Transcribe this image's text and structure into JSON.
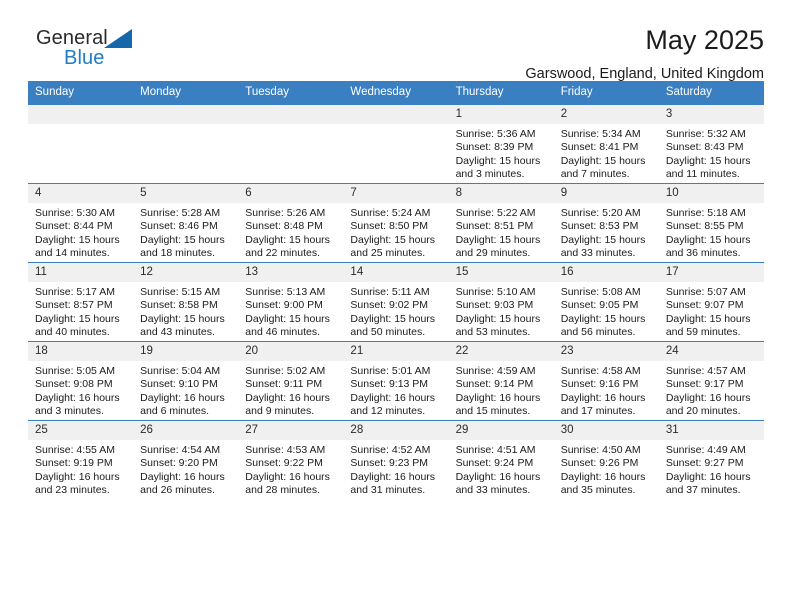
{
  "brand": {
    "name_top": "General",
    "name_bottom": "Blue",
    "accent_color": "#1567ab",
    "triangle_icon": "triangle-icon"
  },
  "header": {
    "title": "May 2025",
    "location": "Garswood, England, United Kingdom"
  },
  "calendar": {
    "header_bg": "#3a7fc1",
    "daynum_bg": "#f0f0f0",
    "weekday_headers": [
      "Sunday",
      "Monday",
      "Tuesday",
      "Wednesday",
      "Thursday",
      "Friday",
      "Saturday"
    ],
    "weeks": [
      [
        {
          "day": "",
          "empty": true
        },
        {
          "day": "",
          "empty": true
        },
        {
          "day": "",
          "empty": true
        },
        {
          "day": "",
          "empty": true
        },
        {
          "day": "1",
          "sunrise": "Sunrise: 5:36 AM",
          "sunset": "Sunset: 8:39 PM",
          "daylight": "Daylight: 15 hours and 3 minutes."
        },
        {
          "day": "2",
          "sunrise": "Sunrise: 5:34 AM",
          "sunset": "Sunset: 8:41 PM",
          "daylight": "Daylight: 15 hours and 7 minutes."
        },
        {
          "day": "3",
          "sunrise": "Sunrise: 5:32 AM",
          "sunset": "Sunset: 8:43 PM",
          "daylight": "Daylight: 15 hours and 11 minutes."
        }
      ],
      [
        {
          "day": "4",
          "sunrise": "Sunrise: 5:30 AM",
          "sunset": "Sunset: 8:44 PM",
          "daylight": "Daylight: 15 hours and 14 minutes."
        },
        {
          "day": "5",
          "sunrise": "Sunrise: 5:28 AM",
          "sunset": "Sunset: 8:46 PM",
          "daylight": "Daylight: 15 hours and 18 minutes."
        },
        {
          "day": "6",
          "sunrise": "Sunrise: 5:26 AM",
          "sunset": "Sunset: 8:48 PM",
          "daylight": "Daylight: 15 hours and 22 minutes."
        },
        {
          "day": "7",
          "sunrise": "Sunrise: 5:24 AM",
          "sunset": "Sunset: 8:50 PM",
          "daylight": "Daylight: 15 hours and 25 minutes."
        },
        {
          "day": "8",
          "sunrise": "Sunrise: 5:22 AM",
          "sunset": "Sunset: 8:51 PM",
          "daylight": "Daylight: 15 hours and 29 minutes."
        },
        {
          "day": "9",
          "sunrise": "Sunrise: 5:20 AM",
          "sunset": "Sunset: 8:53 PM",
          "daylight": "Daylight: 15 hours and 33 minutes."
        },
        {
          "day": "10",
          "sunrise": "Sunrise: 5:18 AM",
          "sunset": "Sunset: 8:55 PM",
          "daylight": "Daylight: 15 hours and 36 minutes."
        }
      ],
      [
        {
          "day": "11",
          "sunrise": "Sunrise: 5:17 AM",
          "sunset": "Sunset: 8:57 PM",
          "daylight": "Daylight: 15 hours and 40 minutes."
        },
        {
          "day": "12",
          "sunrise": "Sunrise: 5:15 AM",
          "sunset": "Sunset: 8:58 PM",
          "daylight": "Daylight: 15 hours and 43 minutes."
        },
        {
          "day": "13",
          "sunrise": "Sunrise: 5:13 AM",
          "sunset": "Sunset: 9:00 PM",
          "daylight": "Daylight: 15 hours and 46 minutes."
        },
        {
          "day": "14",
          "sunrise": "Sunrise: 5:11 AM",
          "sunset": "Sunset: 9:02 PM",
          "daylight": "Daylight: 15 hours and 50 minutes."
        },
        {
          "day": "15",
          "sunrise": "Sunrise: 5:10 AM",
          "sunset": "Sunset: 9:03 PM",
          "daylight": "Daylight: 15 hours and 53 minutes."
        },
        {
          "day": "16",
          "sunrise": "Sunrise: 5:08 AM",
          "sunset": "Sunset: 9:05 PM",
          "daylight": "Daylight: 15 hours and 56 minutes."
        },
        {
          "day": "17",
          "sunrise": "Sunrise: 5:07 AM",
          "sunset": "Sunset: 9:07 PM",
          "daylight": "Daylight: 15 hours and 59 minutes."
        }
      ],
      [
        {
          "day": "18",
          "sunrise": "Sunrise: 5:05 AM",
          "sunset": "Sunset: 9:08 PM",
          "daylight": "Daylight: 16 hours and 3 minutes."
        },
        {
          "day": "19",
          "sunrise": "Sunrise: 5:04 AM",
          "sunset": "Sunset: 9:10 PM",
          "daylight": "Daylight: 16 hours and 6 minutes."
        },
        {
          "day": "20",
          "sunrise": "Sunrise: 5:02 AM",
          "sunset": "Sunset: 9:11 PM",
          "daylight": "Daylight: 16 hours and 9 minutes."
        },
        {
          "day": "21",
          "sunrise": "Sunrise: 5:01 AM",
          "sunset": "Sunset: 9:13 PM",
          "daylight": "Daylight: 16 hours and 12 minutes."
        },
        {
          "day": "22",
          "sunrise": "Sunrise: 4:59 AM",
          "sunset": "Sunset: 9:14 PM",
          "daylight": "Daylight: 16 hours and 15 minutes."
        },
        {
          "day": "23",
          "sunrise": "Sunrise: 4:58 AM",
          "sunset": "Sunset: 9:16 PM",
          "daylight": "Daylight: 16 hours and 17 minutes."
        },
        {
          "day": "24",
          "sunrise": "Sunrise: 4:57 AM",
          "sunset": "Sunset: 9:17 PM",
          "daylight": "Daylight: 16 hours and 20 minutes."
        }
      ],
      [
        {
          "day": "25",
          "sunrise": "Sunrise: 4:55 AM",
          "sunset": "Sunset: 9:19 PM",
          "daylight": "Daylight: 16 hours and 23 minutes."
        },
        {
          "day": "26",
          "sunrise": "Sunrise: 4:54 AM",
          "sunset": "Sunset: 9:20 PM",
          "daylight": "Daylight: 16 hours and 26 minutes."
        },
        {
          "day": "27",
          "sunrise": "Sunrise: 4:53 AM",
          "sunset": "Sunset: 9:22 PM",
          "daylight": "Daylight: 16 hours and 28 minutes."
        },
        {
          "day": "28",
          "sunrise": "Sunrise: 4:52 AM",
          "sunset": "Sunset: 9:23 PM",
          "daylight": "Daylight: 16 hours and 31 minutes."
        },
        {
          "day": "29",
          "sunrise": "Sunrise: 4:51 AM",
          "sunset": "Sunset: 9:24 PM",
          "daylight": "Daylight: 16 hours and 33 minutes."
        },
        {
          "day": "30",
          "sunrise": "Sunrise: 4:50 AM",
          "sunset": "Sunset: 9:26 PM",
          "daylight": "Daylight: 16 hours and 35 minutes."
        },
        {
          "day": "31",
          "sunrise": "Sunrise: 4:49 AM",
          "sunset": "Sunset: 9:27 PM",
          "daylight": "Daylight: 16 hours and 37 minutes."
        }
      ]
    ]
  }
}
